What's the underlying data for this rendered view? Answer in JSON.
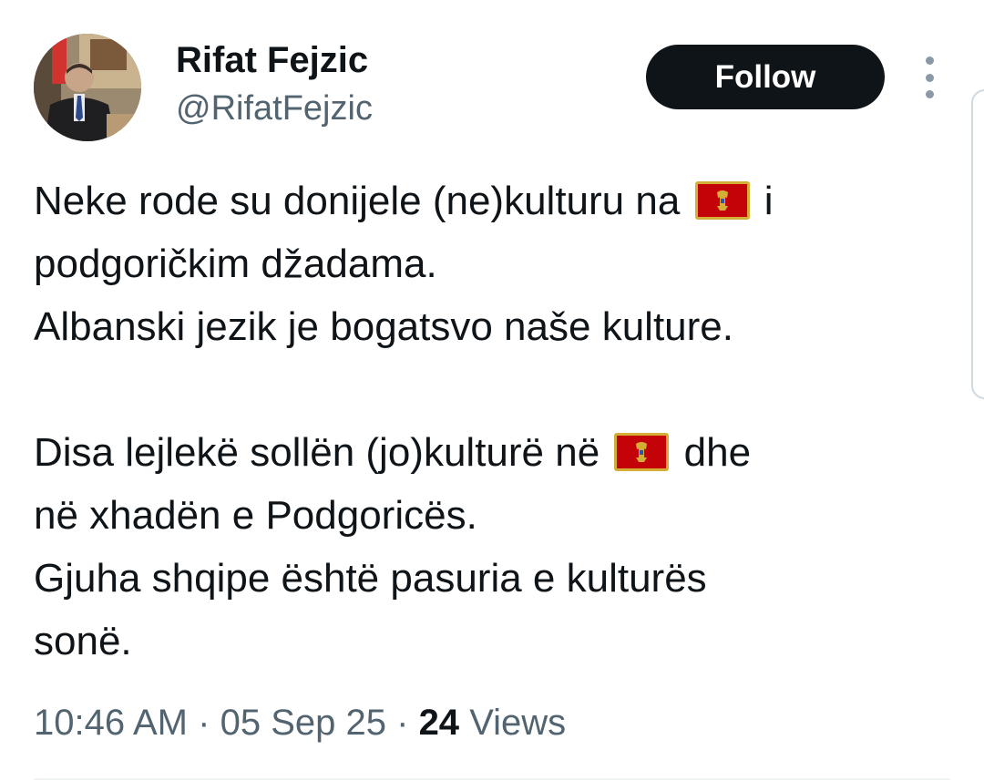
{
  "author": {
    "display_name": "Rifat Fejzic",
    "handle": "@RifatFejzic"
  },
  "follow_label": "Follow",
  "tweet": {
    "paragraph_1": {
      "line_1_before_flag": "Neke rode su donijele (ne)kulturu na",
      "line_1_after_flag": "i",
      "line_2": "podgoričkim džadama.",
      "line_3": "Albanski jezik je bogatsvo naše kulture."
    },
    "paragraph_2": {
      "line_1_before_flag": "Disa lejlekë sollën (jo)kulturë në",
      "line_1_after_flag": "dhe",
      "line_2": "në xhadën e Podgoricës.",
      "line_3": "Gjuha shqipe është pasuria e kulturës",
      "line_4": "sonë."
    },
    "flag_emoji_name": "montenegro-flag-icon"
  },
  "meta": {
    "time": "10:46 AM",
    "separator": "·",
    "date": "05 Sep 25",
    "views_count": "24",
    "views_label": "Views"
  },
  "colors": {
    "text_primary": "#0f1419",
    "text_secondary": "#536471",
    "button_bg": "#0f1419",
    "flag_red": "#c40308",
    "flag_gold": "#d4af37"
  }
}
